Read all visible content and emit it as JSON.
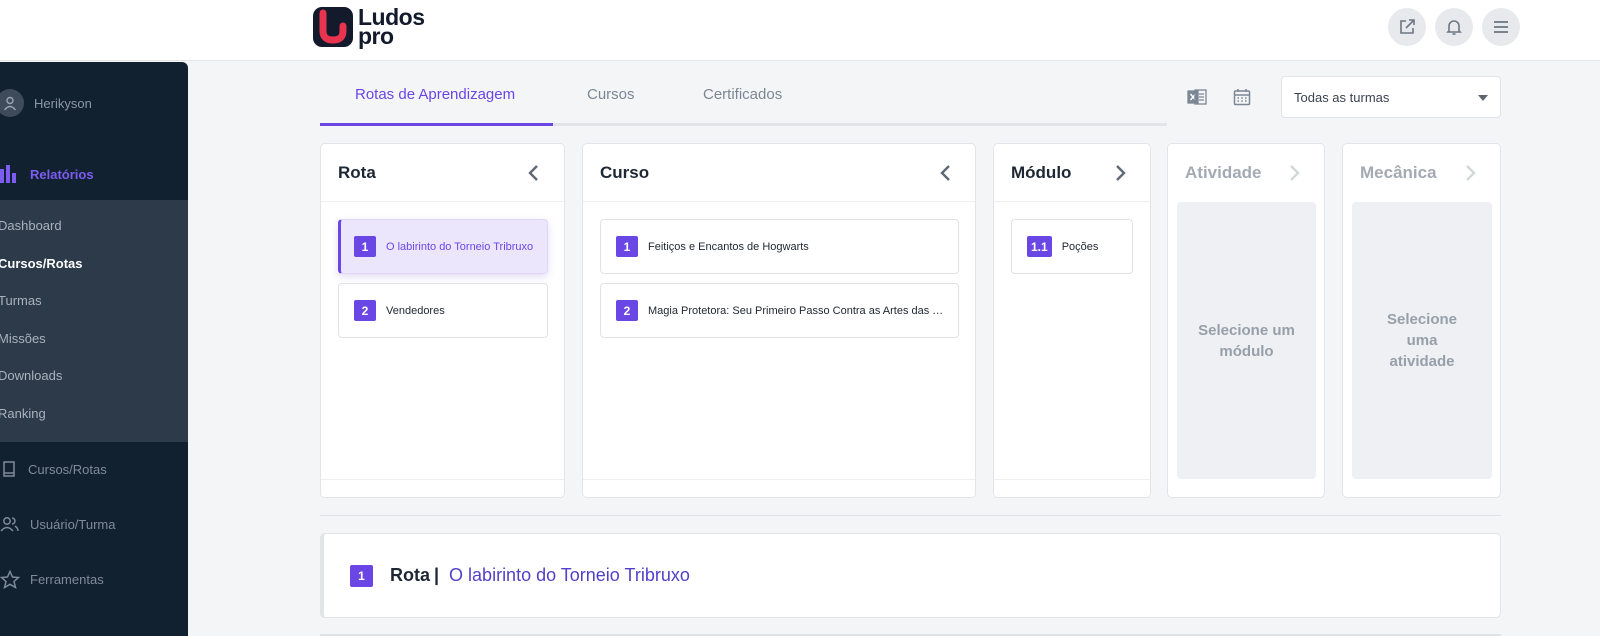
{
  "brand": {
    "line1": "Ludos",
    "line2": "pro"
  },
  "header": {
    "icons": [
      "external-link-icon",
      "bell-icon",
      "menu-icon"
    ]
  },
  "sidebar": {
    "user_name": "Herikyson",
    "section_label": "Relatórios",
    "submenu": [
      "Dashboard",
      "Cursos/Rotas",
      "Turmas",
      "Missões",
      "Downloads",
      "Ranking"
    ],
    "active_submenu": "Cursos/Rotas",
    "nav": [
      "Cursos/Rotas",
      "Usuário/Turma",
      "Ferramentas"
    ]
  },
  "tabs": [
    "Rotas de Aprendizagem",
    "Cursos",
    "Certificados"
  ],
  "active_tab": "Rotas de Aprendizagem",
  "filter": {
    "selected": "Todas as turmas"
  },
  "panels": {
    "rota": {
      "title": "Rota",
      "items": [
        {
          "num": "1",
          "label": "O labirinto do Torneio Tribruxo"
        },
        {
          "num": "2",
          "label": "Vendedores"
        }
      ]
    },
    "curso": {
      "title": "Curso",
      "items": [
        {
          "num": "1",
          "label": "Feitiços e Encantos de Hogwarts"
        },
        {
          "num": "2",
          "label": "Magia Protetora: Seu Primeiro Passo Contra as Artes das Trevas"
        }
      ]
    },
    "modulo": {
      "title": "Módulo",
      "items": [
        {
          "num": "1.1",
          "label": "Poções"
        }
      ]
    },
    "atividade": {
      "title": "Atividade",
      "placeholder": "Selecione um módulo"
    },
    "mecanica": {
      "title": "Mecânica",
      "placeholder": "Selecione uma atividade"
    }
  },
  "summary": {
    "num": "1",
    "label": "Rota",
    "separator": "|",
    "value": "O labirinto do Torneio Tribruxo"
  },
  "colors": {
    "accent": "#6a46e5",
    "sidebar": "#122130",
    "submenu": "#2c3a49"
  }
}
